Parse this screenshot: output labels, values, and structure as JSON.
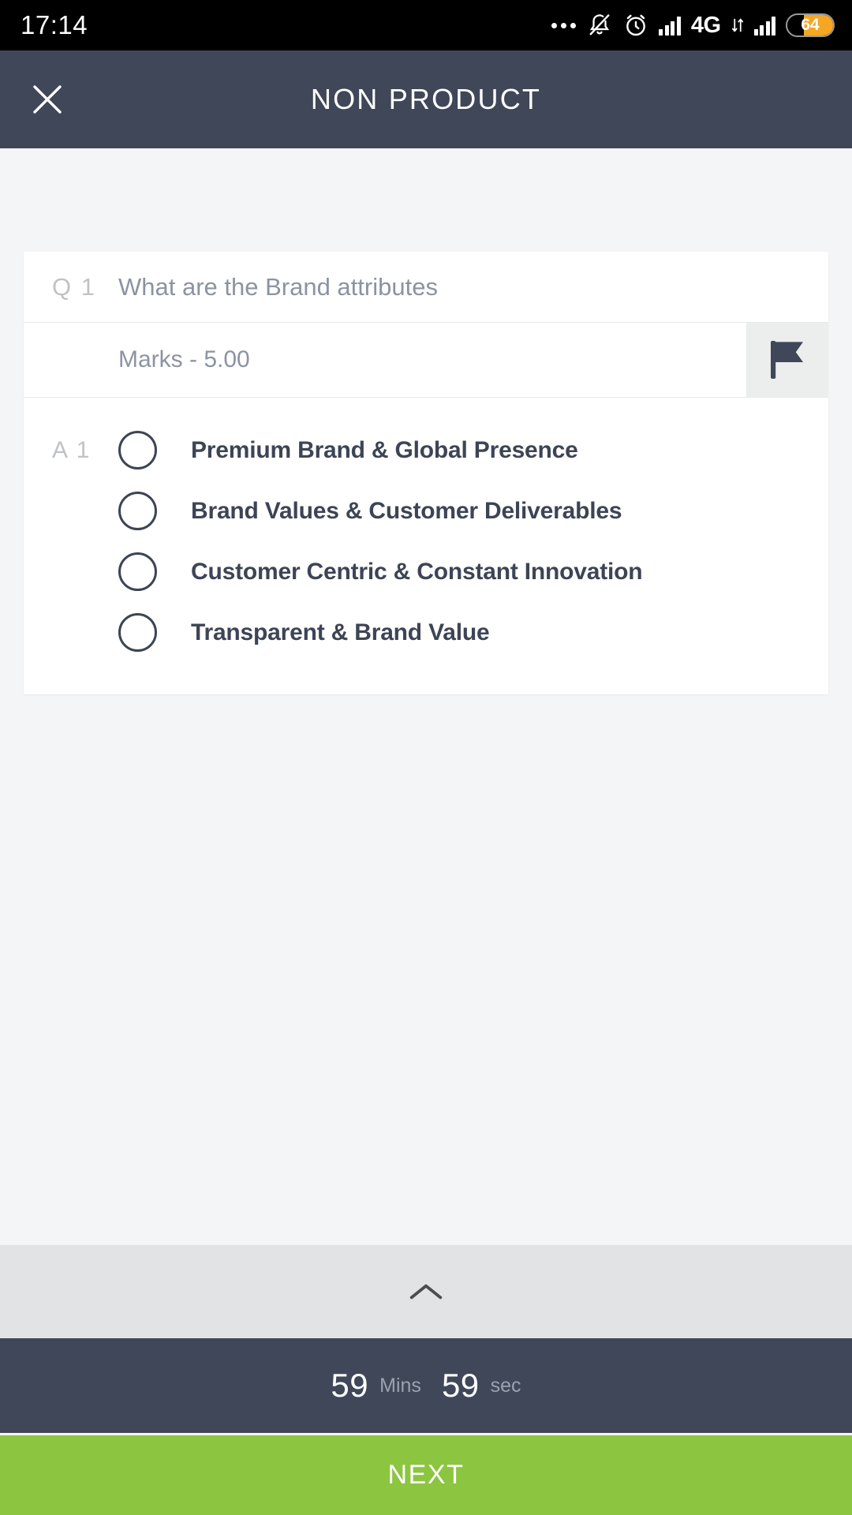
{
  "status_bar": {
    "time": "17:14",
    "battery_level": "64",
    "network_type": "4G",
    "icons": [
      "more-dots-icon",
      "bell-muted-icon",
      "alarm-clock-icon",
      "signal-bars-icon",
      "network-4g-icon",
      "data-transfer-icon",
      "signal-bars-secondary-icon",
      "battery-icon"
    ]
  },
  "header": {
    "title": "NON PRODUCT",
    "close_icon": "close-icon"
  },
  "question": {
    "number_label": "Q 1",
    "text": "What are the Brand attributes",
    "marks_label": "Marks - 5.00",
    "flag_icon": "flag-icon",
    "answer_number_label": "A 1",
    "options": [
      {
        "label": "Premium Brand & Global Presence",
        "selected": false
      },
      {
        "label": "Brand Values & Customer Deliverables",
        "selected": false
      },
      {
        "label": "Customer Centric & Constant Innovation",
        "selected": false
      },
      {
        "label": "Transparent & Brand Value",
        "selected": false
      }
    ]
  },
  "bottom": {
    "expand_icon": "chevron-up-icon",
    "timer": {
      "minutes": "59",
      "minutes_unit": "Mins",
      "seconds": "59",
      "seconds_unit": "sec"
    },
    "next_label": "NEXT"
  },
  "colors": {
    "header_bg": "#3f4758",
    "accent_green": "#8cc540",
    "battery_orange": "#f5a623",
    "page_bg": "#f4f5f6",
    "text_dark": "#3d4455",
    "text_muted": "#8b93a3"
  }
}
